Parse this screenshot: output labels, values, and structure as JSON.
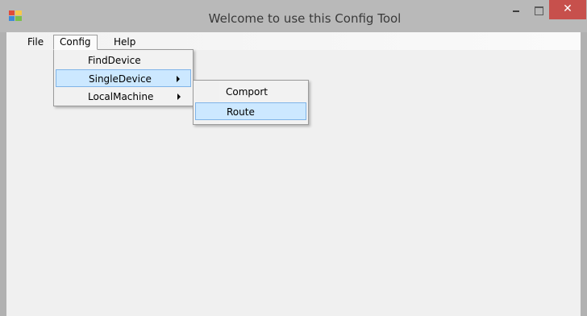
{
  "window": {
    "title": "Welcome  to use this Config Tool",
    "close_glyph": "✕",
    "accent": "#c7504c",
    "icons": [
      "app-icon",
      "minimize-icon",
      "maximize-icon",
      "close-icon"
    ]
  },
  "menubar": {
    "items": [
      {
        "label": "File"
      },
      {
        "label": "Config"
      },
      {
        "label": "Help"
      }
    ]
  },
  "config_menu": {
    "items": [
      {
        "label": "FindDevice"
      },
      {
        "label": "SingleDevice"
      },
      {
        "label": "LocalMachine"
      }
    ]
  },
  "singledevice_submenu": {
    "items": [
      {
        "label": "Comport"
      },
      {
        "label": "Route"
      }
    ]
  },
  "colors": {
    "highlight_fill": "#cce8ff",
    "highlight_border": "#7fb4e8"
  }
}
